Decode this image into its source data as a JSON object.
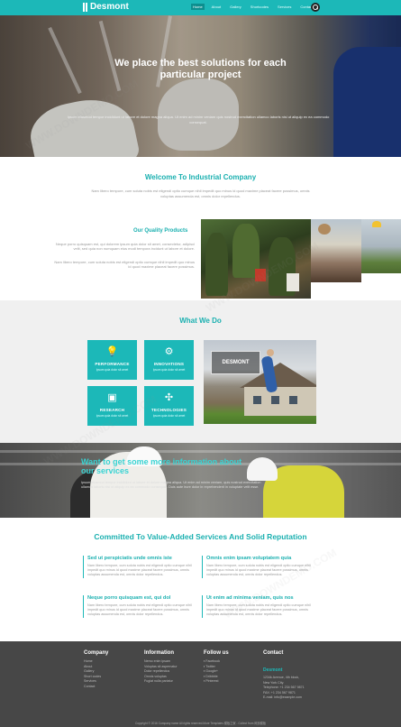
{
  "nav": {
    "brand": "Desmont",
    "items": [
      "Home",
      "About",
      "Gallery",
      "Shortcodes",
      "Services",
      "Contact"
    ],
    "active_index": 0
  },
  "hero": {
    "heading": "We place the best solutions for each particular project",
    "text": "Ipsum eiusmod tempor incididunt ut labore et dolore magna aliqua. Ut enim ad minim veniam quis nostrud exercitation ullamco laboris nisi ut aliquip ex ea commodo consequat."
  },
  "welcome": {
    "title": "Welcome To Industrial Company",
    "text": "Nam libero tempore, cum soluta nobis est eligendi optio cumque nihil impedit quo minus id quod maxime placeat facere possimus, omnis voluptas assumenda est, omnis dolor repellendus."
  },
  "quality": {
    "title": "Our Quality Products",
    "text1": "Neque porro quisquam est, qui dolorem ipsum quia dolor sit amet, consectetur, adipisci velit, sed quia non numquam eius modi tempora incidunt ut labore et dolore.",
    "text2": "Nam libero tempore, cum soluta nobis est eligendi optio cumque nihil impedit quo minus id quod maxime placeat facere possimus."
  },
  "what_we_do": {
    "title": "What We Do",
    "tiles": [
      {
        "label": "PERFORMANCE",
        "sub": "Ipsum quia dolor sit amet",
        "icon": "lightbulb-icon",
        "glyph": "💡"
      },
      {
        "label": "INNOVATIONS",
        "sub": "Ipsum quia dolor sit amet",
        "icon": "gear-icon",
        "glyph": "⚙"
      },
      {
        "label": "RESEARCH",
        "sub": "Ipsum quia dolor sit amet",
        "icon": "monitor-icon",
        "glyph": "▣"
      },
      {
        "label": "TECHNOLOGIES",
        "sub": "Ipsum quia dolor sit amet",
        "icon": "wind-turbine-icon",
        "glyph": "✣"
      }
    ],
    "image_label": "DESMONT"
  },
  "banner": {
    "heading": "Want to get some more information about our services",
    "text": "Ipsum eiusmod tempor incididunt ut labore et dolore magna aliqua. Ut enim ad minim veniam, quis nostrud exercitation ullamco laboris nisi ut aliquip ex ea commodo consequat. Duis aute irure dolor in reprehenderit in voluptate velit esse."
  },
  "committed": {
    "title": "Committed To Value-Added Services And Solid Reputation",
    "items": [
      {
        "title": "Sed ut perspiciatis unde omnis iste",
        "text": "Nam libero tempore, cum soluta nobis est eligendi optio cumque nihil impedit quo minus id quod maxime placeat facere possimus, omnis voluptas assumenda est, omnis dolor repellendus."
      },
      {
        "title": "Omnis enim ipsam voluptatem quia",
        "text": "Nam libero tempore, cum soluta nobis est eligendi optio cumque nihil impedit quo minus id quod maxime placeat facere possimus, omnis voluptas assumenda est, omnis dolor repellendus."
      },
      {
        "title": "Neque porro quisquam est, qui dol",
        "text": "Nam libero tempore, cum soluta nobis est eligendi optio cumque nihil impedit quo minus id quod maxime placeat facere possimus, omnis voluptas assumenda est, omnis dolor repellendus."
      },
      {
        "title": "Ut enim ad minima veniam, quis nos",
        "text": "Nam libero tempore, cum soluta nobis est eligendi optio cumque nihil impedit quo minus id quod maxime placeat facere possimus, omnis voluptas assumenda est, omnis dolor repellendus."
      }
    ]
  },
  "footer": {
    "company": {
      "title": "Company",
      "links": [
        "Home",
        "About",
        "Gallery",
        "Short codes",
        "Services",
        "Contact"
      ]
    },
    "information": {
      "title": "Information",
      "links": [
        "Nemo enim ipsam",
        "Voluptas sit aspernatur",
        "Dolor repellendus",
        "Omnis voluptas",
        "Fugiat nulla pariatur"
      ]
    },
    "follow": {
      "title": "Follow us",
      "links": [
        "Facebook",
        "Twitter",
        "Google+",
        "Dribbble",
        "Pinterest"
      ]
    },
    "contact": {
      "title": "Contact",
      "brand": "Desmont",
      "lines": [
        "1234k Avenue, 4th block,",
        "New York City.",
        "Telephone: +1 234 567 9871",
        "FAX: +1 234 567 9871",
        "E-mail: info@example.com"
      ]
    },
    "copyright": "Copyright © 2016 Company name All rights reserved.More Templates 模板之家 - Collect from 网页模板"
  },
  "watermark": "WWW.DOWNDEMO.COM",
  "colors": {
    "accent": "#1cb8b8",
    "footer": "#474747"
  }
}
